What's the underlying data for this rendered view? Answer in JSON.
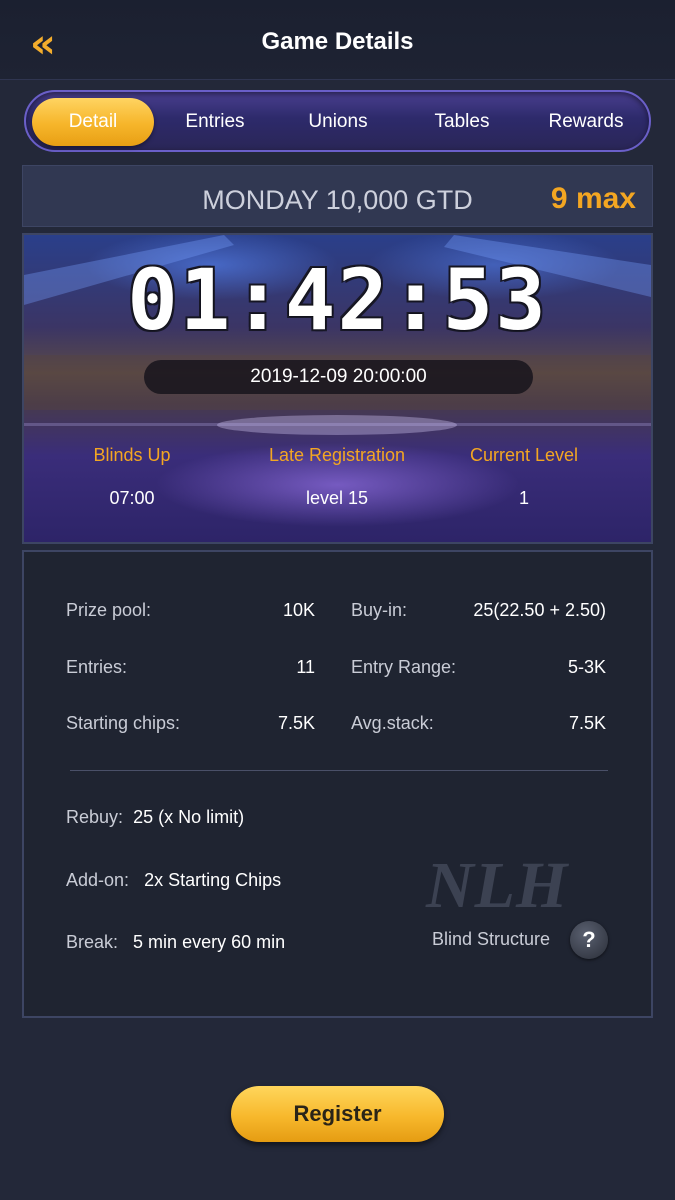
{
  "header": {
    "back_icon": "double-chevron-left-icon",
    "back_glyph": "«",
    "title": "Game Details"
  },
  "tabs": [
    {
      "label": "Detail",
      "active": true
    },
    {
      "label": "Entries",
      "active": false
    },
    {
      "label": "Unions",
      "active": false
    },
    {
      "label": "Tables",
      "active": false
    },
    {
      "label": "Rewards",
      "active": false
    }
  ],
  "tournament": {
    "name": "MONDAY 10,000 GTD",
    "max_players": "9 max"
  },
  "hero": {
    "countdown": "01:42:53",
    "start_datetime": "2019-12-09 20:00:00",
    "blinds_up_label": "Blinds Up",
    "blinds_up_value": "07:00",
    "late_reg_label": "Late Registration",
    "late_reg_value": "level 15",
    "current_level_label": "Current Level",
    "current_level_value": "1"
  },
  "details": {
    "prize_pool_label": "Prize pool:",
    "prize_pool_value": "10K",
    "buy_in_label": "Buy-in:",
    "buy_in_value": "25(22.50 + 2.50)",
    "entries_label": "Entries:",
    "entries_value": "11",
    "entry_range_label": "Entry Range:",
    "entry_range_value": "5-3K",
    "starting_chips_label": "Starting chips:",
    "starting_chips_value": "7.5K",
    "avg_stack_label": "Avg.stack:",
    "avg_stack_value": "7.5K",
    "rebuy_label": "Rebuy:",
    "rebuy_value": "25 (x No limit)",
    "addon_label": "Add-on:",
    "addon_value": "2x Starting Chips",
    "break_label": "Break:",
    "break_value": "5 min every 60 min",
    "game_type": "NLH",
    "blind_structure_label": "Blind Structure",
    "help_icon": "question-icon",
    "help_glyph": "?"
  },
  "register_label": "Register",
  "colors": {
    "accent": "#f3a622",
    "background": "#232839",
    "tab_active": "#f6b52a"
  }
}
